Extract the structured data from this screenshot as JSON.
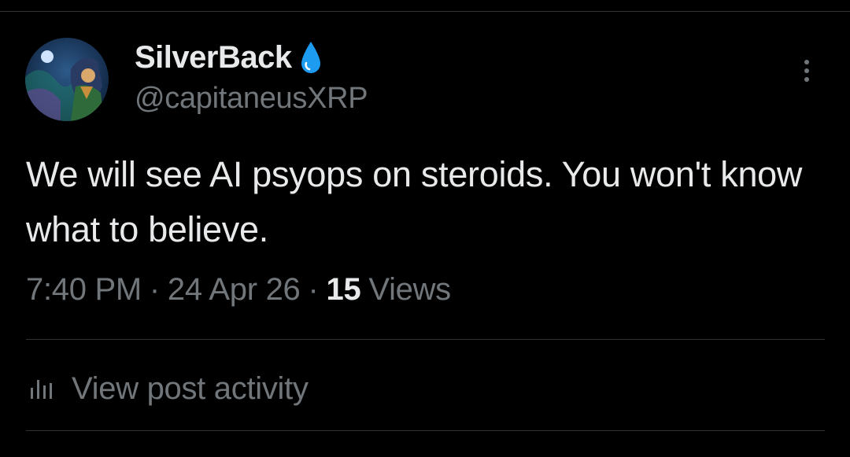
{
  "post": {
    "author": {
      "display_name": "SilverBack",
      "handle": "@capitaneusXRP",
      "badge_icon": "water-drop-icon",
      "avatar_icon": "character-avatar"
    },
    "text": "We will see AI psyops on steroids. You won't know what to believe.",
    "time": "7:40 PM",
    "separator": "·",
    "date": "24 Apr 26",
    "views_count": "15",
    "views_label": "Views",
    "more_icon": "more-vertical-icon"
  },
  "actions": {
    "view_activity_label": "View post activity",
    "view_activity_icon": "bar-chart-icon"
  },
  "colors": {
    "background": "#000000",
    "primary_text": "#e7e9ea",
    "secondary_text": "#71767b",
    "divider": "#2f3336",
    "drop_blue": "#1d9bf0"
  }
}
